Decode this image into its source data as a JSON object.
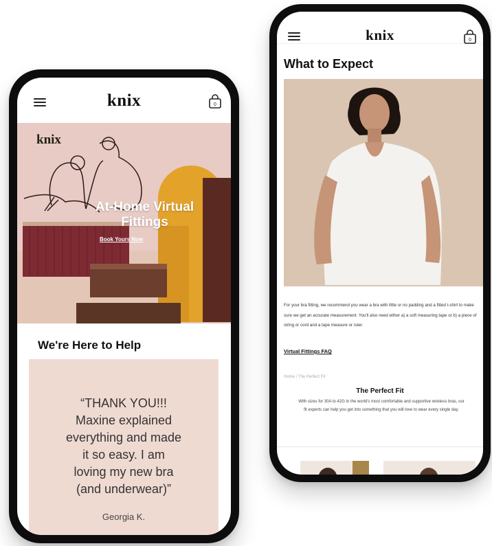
{
  "left_phone": {
    "brand": "knix",
    "hero": {
      "brand": "knix",
      "title_line1": "At-Home Virtual",
      "title_line2": "Fittings",
      "cta": "Book Yours Now"
    },
    "section_title": "We're Here to Help",
    "testimonial": {
      "quote_lines": [
        "“THANK YOU!!!",
        "Maxine explained",
        "everything and made",
        "it so easy. I am",
        "loving my new bra",
        "(and underwear)”"
      ],
      "author": "Georgia K."
    },
    "bag_count": "0"
  },
  "right_phone": {
    "brand": "knix",
    "bag_count": "0",
    "page_title": "What to Expect",
    "body_text": "For your bra fitting, we recommend you wear a bra with little or no padding and a fitted t-shirt to make sure we get an accurate measurement. You'll also need either a) a soft measuring tape or b) a piece of string or cord and a tape measure or ruler.",
    "faq_link": "Virtual Fittings FAQ",
    "breadcrumb": "Home / The Perfect Fit",
    "fit_title": "The Perfect Fit",
    "fit_desc": "With sizes for 30A to 42G in the world's most comfortable and supportive wireless bras, our fit experts can help you get into something that you will love to wear every single day."
  },
  "icons": [
    "menu-icon",
    "shopping-bag-icon"
  ],
  "colors": {
    "hero_pink": "#e8cbc5",
    "testimonial_bg": "#efdad2",
    "velvet_red": "#7e2a33",
    "curtain_gold": "#e3a22a",
    "photo_bg": "#d9c5b2"
  }
}
